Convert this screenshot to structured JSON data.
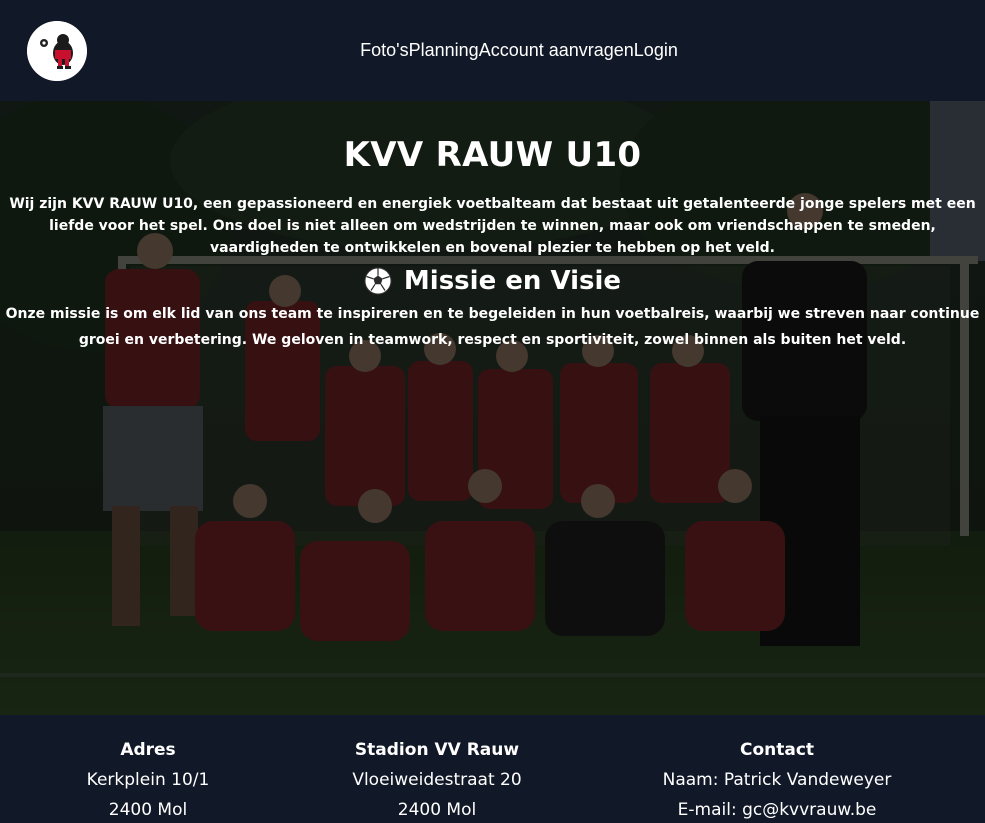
{
  "header": {
    "logo_icon": "club-logo-icon",
    "nav": [
      {
        "label": "Foto's"
      },
      {
        "label": "Planning"
      },
      {
        "label": "Account aanvragen"
      },
      {
        "label": "Login"
      }
    ]
  },
  "hero": {
    "title": "KVV RAUW U10",
    "intro": "Wij zijn KVV RAUW U10, een gepassioneerd en energiek voetbalteam dat bestaat uit getalenteerde jonge spelers met een liefde voor het spel. Ons doel is niet alleen om wedstrijden te winnen, maar ook om vriendschappen te smeden, vaardigheden te ontwikkelen en bovenal plezier te hebben op het veld.",
    "mission_icon": "soccer-ball-icon",
    "mission_title": "Missie en Visie",
    "mission_text": "Onze missie is om elk lid van ons team te inspireren en te begeleiden in hun voetbalreis, waarbij we streven naar continue groei en verbetering. We geloven in teamwork, respect en sportiviteit, zowel binnen als buiten het veld."
  },
  "footer": {
    "address": {
      "title": "Adres",
      "line1": "Kerkplein 10/1",
      "line2": "2400 Mol"
    },
    "stadium": {
      "title": "Stadion VV Rauw",
      "line1": "Vloeiweidestraat 20",
      "line2": "2400 Mol"
    },
    "contact": {
      "title": "Contact",
      "line1": "Naam: Patrick Vandeweyer",
      "line2": "E-mail: gc@kvvrauw.be"
    }
  },
  "colors": {
    "background": "#111827",
    "text": "#ffffff",
    "kit_red": "#b3192a"
  }
}
